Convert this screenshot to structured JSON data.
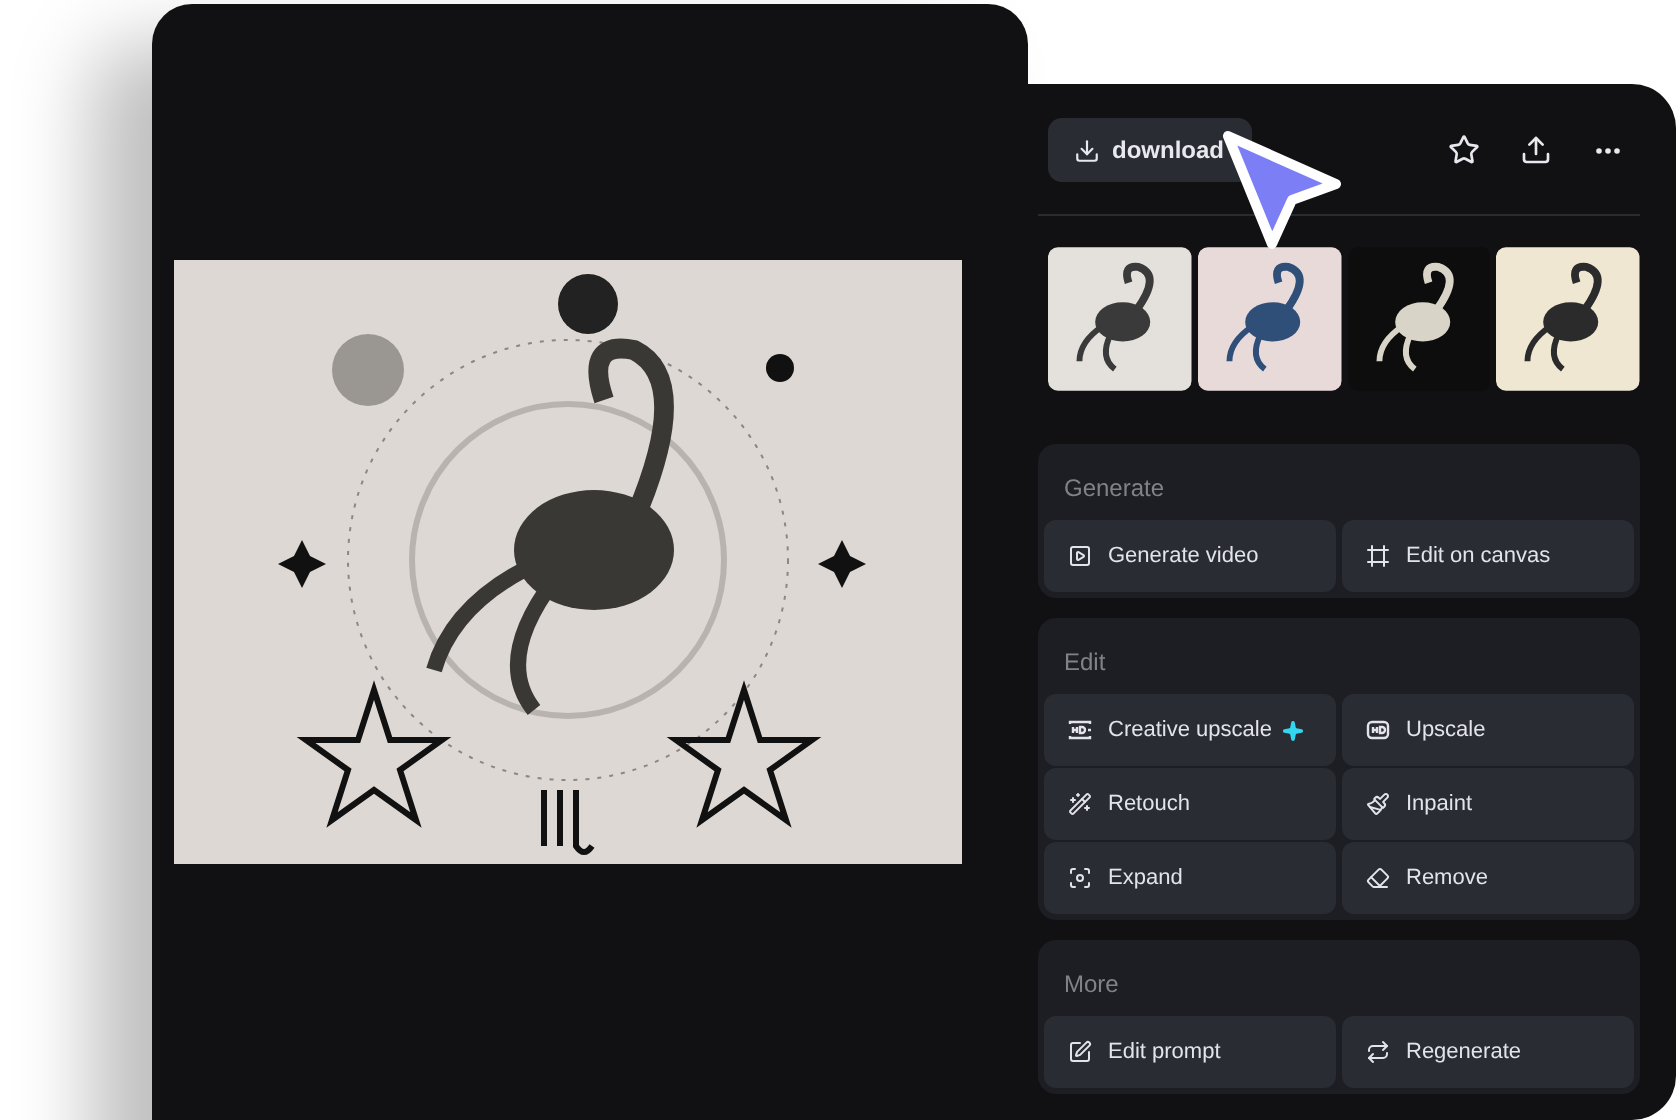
{
  "toolbar": {
    "download_label": "download"
  },
  "sections": [
    {
      "title": "Generate",
      "actions": [
        {
          "label": "Generate video"
        },
        {
          "label": "Edit on canvas"
        }
      ]
    },
    {
      "title": "Edit",
      "actions": [
        {
          "label": "Creative upscale"
        },
        {
          "label": "Upscale"
        },
        {
          "label": "Retouch"
        },
        {
          "label": "Inpaint"
        },
        {
          "label": "Expand"
        },
        {
          "label": "Remove"
        }
      ]
    },
    {
      "title": "More",
      "actions": [
        {
          "label": "Edit prompt"
        },
        {
          "label": "Regenerate"
        }
      ]
    }
  ]
}
